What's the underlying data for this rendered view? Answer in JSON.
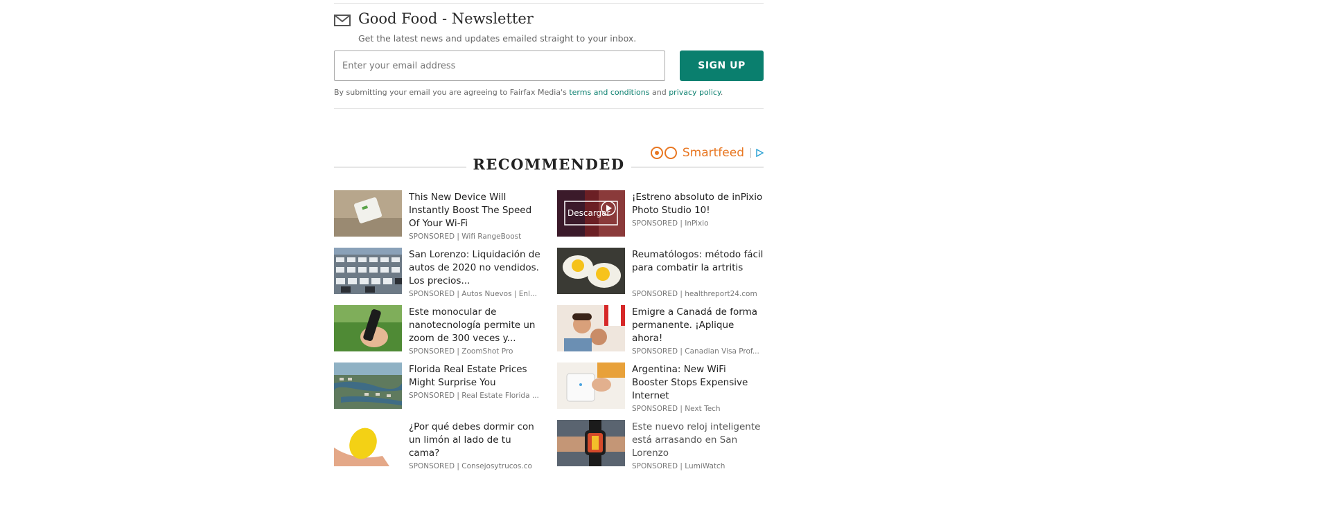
{
  "newsletter": {
    "title": "Good Food - Newsletter",
    "subtitle": "Get the latest news and updates emailed straight to your inbox.",
    "email_placeholder": "Enter your email address",
    "signup_label": "SIGN UP",
    "legal_prefix": "By submitting your email you are agreeing to Fairfax Media's",
    "terms_link": "terms and conditions",
    "legal_and": "and",
    "privacy_link": "privacy policy",
    "legal_suffix": "."
  },
  "smartfeed": {
    "label": "Smartfeed",
    "brand_color": "#e87722"
  },
  "recommended": {
    "title": "RECOMMENDED",
    "items": [
      {
        "title": "This New Device Will Instantly Boost The Speed Of Your Wi-Fi",
        "source": "SPONSORED | Wifi RangeBoost",
        "thumb": "wifi-device-thumbnail"
      },
      {
        "title": "¡Estreno absoluto de inPixio Photo Studio 10!",
        "source": "SPONSORED | InPixio",
        "thumb": "inpixio-video-thumbnail",
        "thumb_text": "Descargar"
      },
      {
        "title": "San Lorenzo: Liquidación de autos de 2020 no vendidos. Los precios...",
        "source": "SPONSORED | Autos Nuevos | Enl...",
        "thumb": "parked-cars-thumbnail"
      },
      {
        "title": "Reumatólogos: método fácil para combatir la artritis",
        "source": "SPONSORED | healthreport24.com",
        "thumb": "fried-eggs-thumbnail"
      },
      {
        "title": "Este monocular de nanotecnología permite un zoom de 300 veces y...",
        "source": "SPONSORED | ZoomShot Pro",
        "thumb": "monocular-thumbnail"
      },
      {
        "title": "Emigre a Canadá de forma permanente. ¡Aplique ahora!",
        "source": "SPONSORED | Canadian Visa Prof...",
        "thumb": "canada-couple-thumbnail"
      },
      {
        "title": "Florida Real Estate Prices Might Surprise You",
        "source": "SPONSORED | Real Estate Florida ...",
        "thumb": "florida-aerial-thumbnail"
      },
      {
        "title": "Argentina: New WiFi Booster Stops Expensive Internet",
        "source": "SPONSORED | Next Tech",
        "thumb": "wifi-booster-thumbnail"
      },
      {
        "title": "¿Por qué debes dormir con un limón al lado de tu cama?",
        "source": "SPONSORED | Consejosytrucos.co",
        "thumb": "lemon-hand-thumbnail"
      },
      {
        "title": "Este nuevo reloj inteligente está arrasando en San Lorenzo",
        "source": "SPONSORED | LumiWatch",
        "thumb": "smartwatch-thumbnail"
      }
    ]
  },
  "colors": {
    "accent": "#0a7f6e",
    "text": "#222222",
    "muted": "#777777"
  }
}
